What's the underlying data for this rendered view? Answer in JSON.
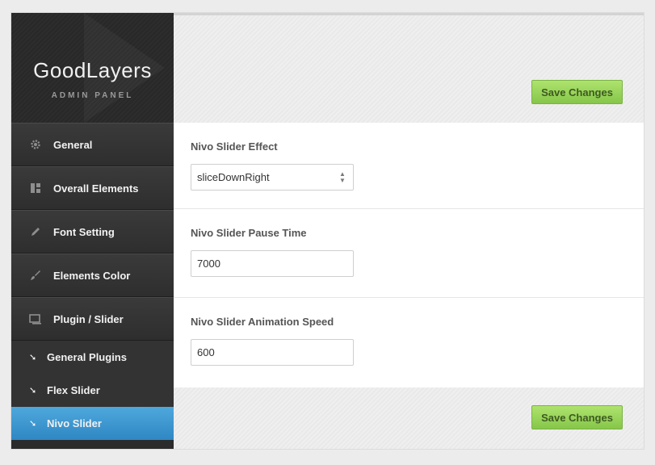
{
  "brand": {
    "title": "GoodLayers",
    "subtitle": "ADMIN PANEL"
  },
  "sidebar": {
    "items": [
      {
        "label": "General",
        "icon": "gear-icon"
      },
      {
        "label": "Overall Elements",
        "icon": "layout-icon"
      },
      {
        "label": "Font Setting",
        "icon": "pen-icon"
      },
      {
        "label": "Elements Color",
        "icon": "brush-icon"
      },
      {
        "label": "Plugin / Slider",
        "icon": "slider-icon"
      }
    ],
    "subitems": [
      {
        "label": "General Plugins"
      },
      {
        "label": "Flex Slider"
      },
      {
        "label": "Nivo Slider",
        "active": true
      }
    ]
  },
  "actions": {
    "save_label": "Save Changes"
  },
  "fields": {
    "effect": {
      "label": "Nivo Slider Effect",
      "value": "sliceDownRight"
    },
    "pause": {
      "label": "Nivo Slider Pause Time",
      "value": "7000"
    },
    "speed": {
      "label": "Nivo Slider Animation Speed",
      "value": "600"
    }
  },
  "colors": {
    "accent": "#3b96d1",
    "save_green": "#94d258"
  }
}
